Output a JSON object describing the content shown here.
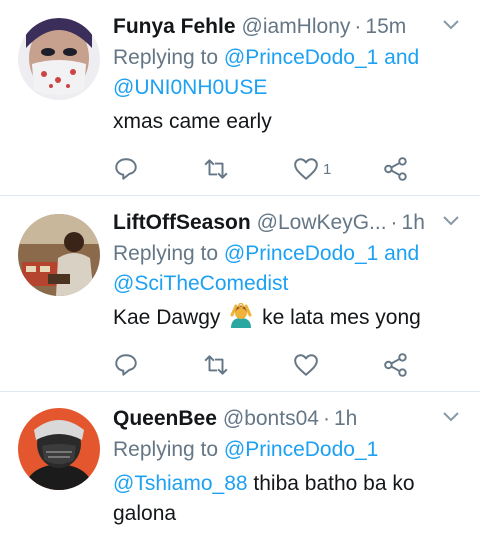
{
  "tweets": [
    {
      "name": "Funya Fehle",
      "handle": "@iamHlony",
      "sep": "·",
      "time": "15m",
      "reply_prefix": "Replying to",
      "mention_1": "@PrinceDodo_1",
      "reply_and": "and",
      "mention_2": "@UNI0NH0USE",
      "text": "xmas came early",
      "like_count": "1"
    },
    {
      "name": "LiftOffSeason",
      "handle": "@LowKeyG...",
      "sep": "·",
      "time": "1h",
      "reply_prefix": "Replying to",
      "mention_1": "@PrinceDodo_1",
      "reply_and": "and",
      "mention_2": "@SciTheComedist",
      "text_before": "Kae Dawgy",
      "text_after": "ke lata mes yong",
      "emoji": "person-gesturing-ok-emoji"
    },
    {
      "name": "QueenBee",
      "handle": "@bonts04",
      "sep": "·",
      "time": "1h",
      "reply_prefix": "Replying to",
      "mention_1": "@PrinceDodo_1",
      "inline_mention": "@Tshiamo_88",
      "text": "thiba batho ba ko galona"
    }
  ],
  "icons": {
    "reply": "reply-icon",
    "retweet": "retweet-icon",
    "like": "heart-icon",
    "share": "share-icon",
    "more": "chevron-down-icon"
  },
  "colors": {
    "link": "#1da1f2",
    "muted": "#657786",
    "text": "#14171a",
    "divider": "#e1e8ed"
  }
}
